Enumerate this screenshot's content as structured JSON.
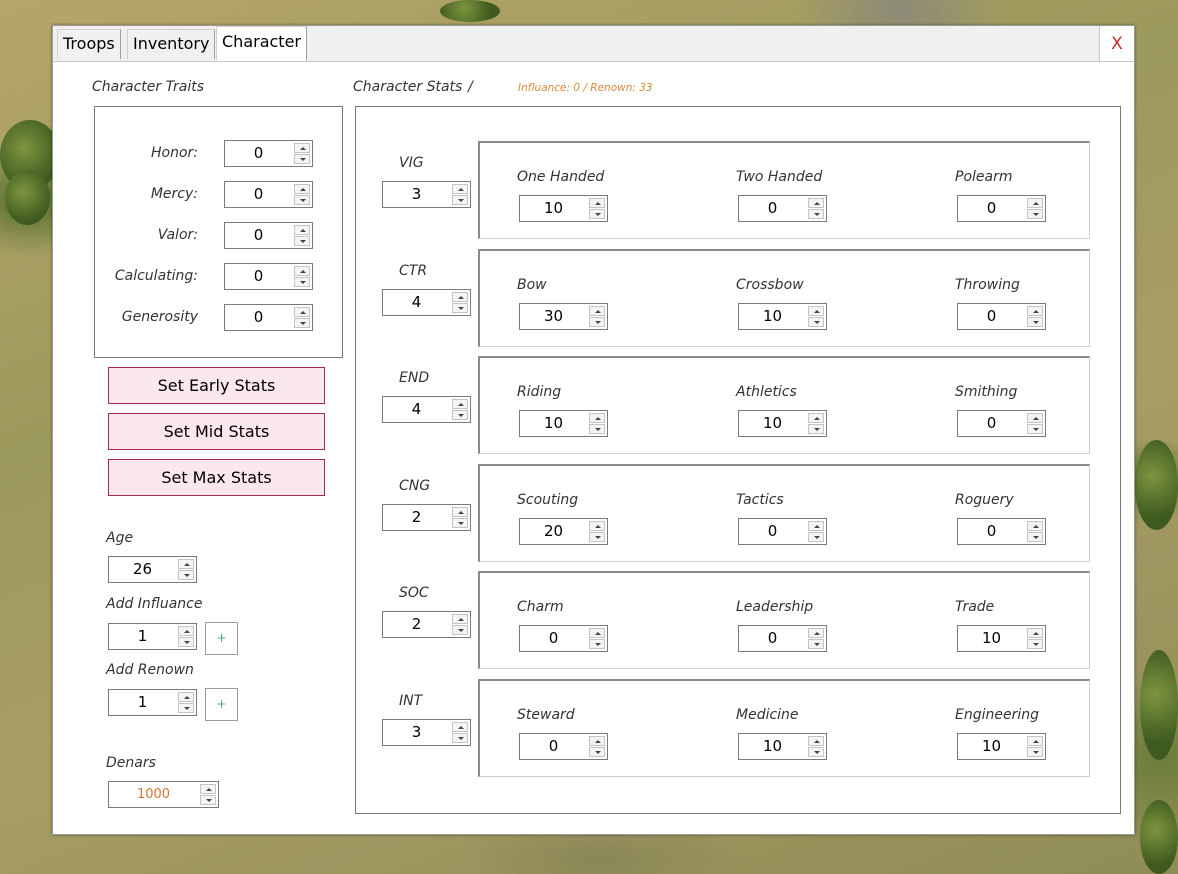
{
  "tabs": [
    {
      "label": "Troops"
    },
    {
      "label": "Inventory"
    },
    {
      "label": "Character"
    }
  ],
  "close_label": "X",
  "traits": {
    "title": "Character Traits",
    "items": [
      {
        "label": "Honor:",
        "value": "0"
      },
      {
        "label": "Mercy:",
        "value": "0"
      },
      {
        "label": "Valor:",
        "value": "0"
      },
      {
        "label": "Calculating:",
        "value": "0"
      },
      {
        "label": "Generosity",
        "value": "0"
      }
    ]
  },
  "buttons": {
    "early": "Set Early Stats",
    "mid": "Set Mid Stats",
    "max": "Set Max Stats"
  },
  "age": {
    "label": "Age",
    "value": "26"
  },
  "influence": {
    "label": "Add Influance",
    "value": "1",
    "plus": "+"
  },
  "renown": {
    "label": "Add Renown",
    "value": "1",
    "plus": "+"
  },
  "denars": {
    "label": "Denars",
    "value": "1000"
  },
  "stats": {
    "title": "Character Stats",
    "separator": "/",
    "summary": "Influance: 0 / Renown: 33",
    "attributes": [
      {
        "name": "VIG",
        "value": "3",
        "skills": [
          {
            "label": "One Handed",
            "value": "10"
          },
          {
            "label": "Two Handed",
            "value": "0"
          },
          {
            "label": "Polearm",
            "value": "0"
          }
        ]
      },
      {
        "name": "CTR",
        "value": "4",
        "skills": [
          {
            "label": "Bow",
            "value": "30"
          },
          {
            "label": "Crossbow",
            "value": "10"
          },
          {
            "label": "Throwing",
            "value": "0"
          }
        ]
      },
      {
        "name": "END",
        "value": "4",
        "skills": [
          {
            "label": "Riding",
            "value": "10"
          },
          {
            "label": "Athletics",
            "value": "10"
          },
          {
            "label": "Smithing",
            "value": "0"
          }
        ]
      },
      {
        "name": "CNG",
        "value": "2",
        "skills": [
          {
            "label": "Scouting",
            "value": "20"
          },
          {
            "label": "Tactics",
            "value": "0"
          },
          {
            "label": "Roguery",
            "value": "0"
          }
        ]
      },
      {
        "name": "SOC",
        "value": "2",
        "skills": [
          {
            "label": "Charm",
            "value": "0"
          },
          {
            "label": "Leadership",
            "value": "0"
          },
          {
            "label": "Trade",
            "value": "10"
          }
        ]
      },
      {
        "name": "INT",
        "value": "3",
        "skills": [
          {
            "label": "Steward",
            "value": "0"
          },
          {
            "label": "Medicine",
            "value": "10"
          },
          {
            "label": "Engineering",
            "value": "10"
          }
        ]
      }
    ]
  },
  "colors": {
    "accent_pink_border": "#a8294c",
    "accent_pink_fill": "#fbe7ee",
    "summary_orange": "#d88a3a",
    "close_red": "#c92b2b",
    "plus_green": "#3ab07f"
  }
}
